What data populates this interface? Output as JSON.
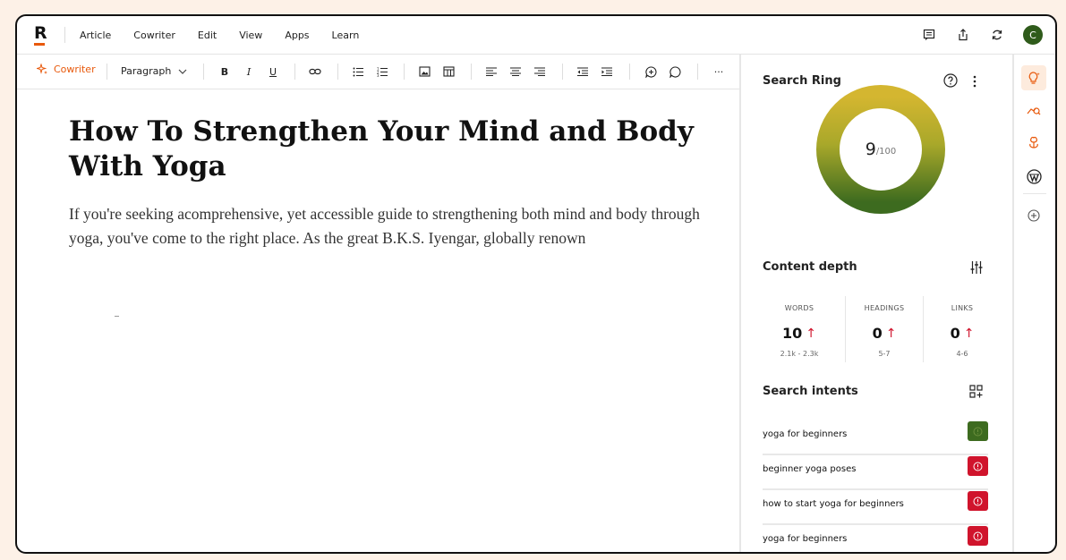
{
  "menu": [
    "Article",
    "Cowriter",
    "Edit",
    "View",
    "Apps",
    "Learn"
  ],
  "user": {
    "avatar_initial": "C",
    "avatar_color": "#2f5b1b"
  },
  "toolbar": {
    "cowriter_label": "Cowriter",
    "block_type": "Paragraph",
    "bold": "B",
    "italic": "I",
    "underline": "U",
    "more": "···"
  },
  "document": {
    "title": "How To Strengthen Your Mind and Body With Yoga",
    "body": "If you're seeking acomprehensive, yet accessible guide to strengthening both mind and body through yoga, you've come to the right place. As the great B.K.S. Iyengar, globally renown"
  },
  "search_ring": {
    "title": "Search Ring",
    "score": "9",
    "max": "/100",
    "score_fraction": 0.09
  },
  "content_depth": {
    "title": "Content depth",
    "metrics": [
      {
        "label": "WORDS",
        "value": "10",
        "range": "2.1k - 2.3k"
      },
      {
        "label": "HEADINGS",
        "value": "0",
        "range": "5-7"
      },
      {
        "label": "LINKS",
        "value": "0",
        "range": "4-6"
      }
    ],
    "arrow": "↑"
  },
  "search_intents": {
    "title": "Search intents",
    "items": [
      {
        "text": "yoga for beginners",
        "status": "met",
        "color": "#3d6b1f"
      },
      {
        "text": "beginner yoga poses",
        "status": "missing",
        "color": "#d0142c"
      },
      {
        "text": "how to start yoga for beginners",
        "status": "missing",
        "color": "#d0142c"
      },
      {
        "text": "yoga for beginners",
        "status": "missing",
        "color": "#d0142c"
      }
    ]
  },
  "colors": {
    "accent": "#e8590c",
    "ring_top": "#d4b630",
    "ring_bottom": "#3d6b1f",
    "bad": "#d0142c"
  },
  "rail_icons": [
    "lightbulb-icon",
    "chart-search-icon",
    "brain-icon",
    "wordpress-icon",
    "add-icon"
  ]
}
